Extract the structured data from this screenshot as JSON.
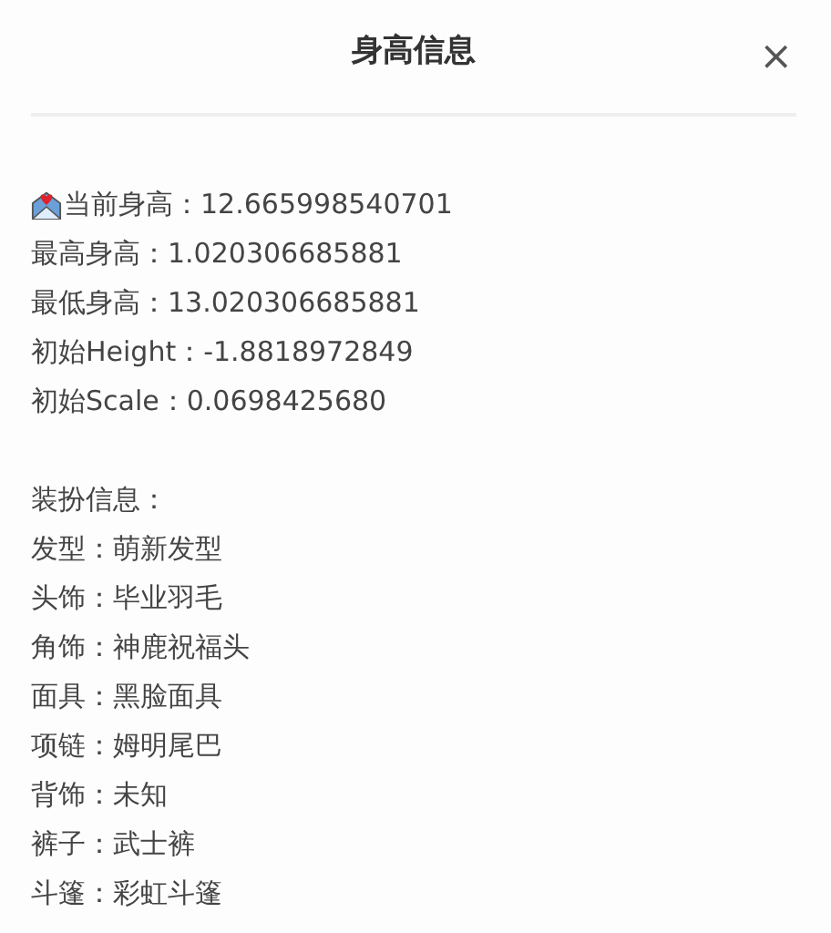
{
  "dialog": {
    "title": "身高信息",
    "close": "×"
  },
  "stats": [
    "当前身高：12.665998540701",
    "最高身高：1.020306685881",
    "最低身高：13.020306685881",
    "初始Height：-1.8818972849",
    "初始Scale：0.0698425680"
  ],
  "outfit_heading": "装扮信息：",
  "outfit": [
    "发型：萌新发型",
    "头饰：毕业羽毛",
    "角饰：神鹿祝福头",
    "面具：黑脸面具",
    "项链：姆明尾巴",
    "背饰：未知",
    "裤子：武士裤",
    "斗篷：彩虹斗篷"
  ]
}
